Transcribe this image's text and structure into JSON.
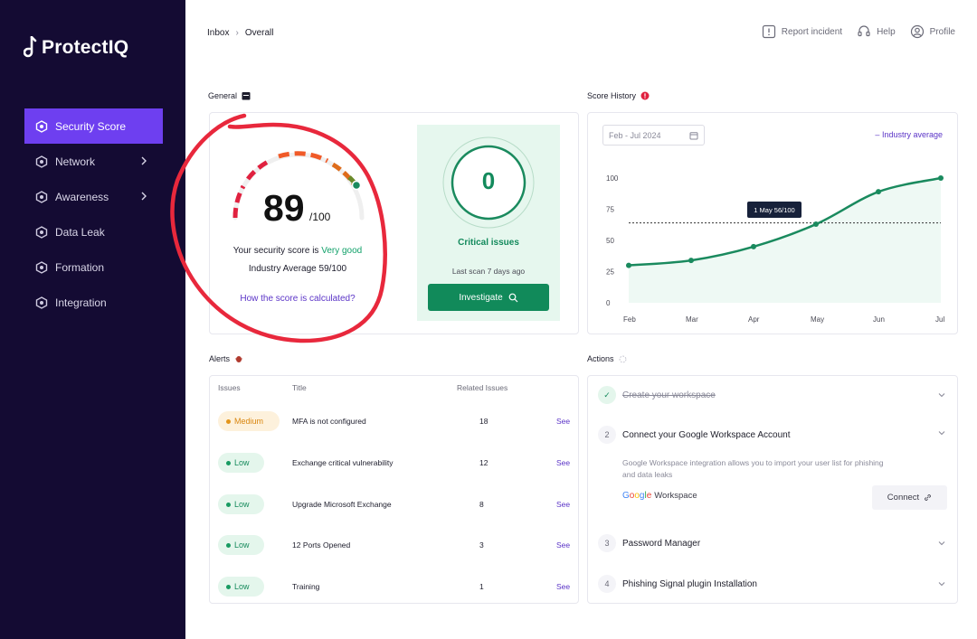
{
  "app": {
    "name": "ProtectIQ"
  },
  "sidebar": {
    "items": [
      {
        "label": "Security Score",
        "icon": "hexagon-icon",
        "active": true
      },
      {
        "label": "Network",
        "icon": "hexagon-icon",
        "has_children": true
      },
      {
        "label": "Awareness",
        "icon": "hexagon-icon",
        "has_children": true
      },
      {
        "label": "Data Leak",
        "icon": "hexagon-icon"
      },
      {
        "label": "Formation",
        "icon": "hexagon-icon"
      },
      {
        "label": "Integration",
        "icon": "hexagon-icon"
      }
    ]
  },
  "header": {
    "breadcrumb": [
      "Inbox",
      "Overall"
    ],
    "actions": {
      "report": "Report incident",
      "help": "Help",
      "profile": "Profile"
    }
  },
  "general": {
    "title": "General",
    "score": "89",
    "score_max": "/100",
    "score_fraction": 0.89,
    "score_text_prefix": "Your security score is",
    "score_rating": "Very good",
    "industry_average": "Industry Average 59/100",
    "how_link": "How the score is calculated?",
    "critical": {
      "count": "0",
      "label": "Critical issues",
      "last_scan": "Last scan 7 days ago",
      "button": "Investigate"
    }
  },
  "score_history": {
    "title": "Score History",
    "date_range": "Feb - Jul 2024",
    "legend": "Industry average",
    "tooltip": "1 May 56/100"
  },
  "chart_data": {
    "type": "line",
    "x": [
      "Feb",
      "Mar",
      "Apr",
      "May",
      "Jun",
      "Jul"
    ],
    "series": [
      {
        "values": [
          30,
          34,
          45,
          63,
          89,
          100
        ]
      }
    ],
    "reference_line": 64,
    "yticks": [
      0,
      25,
      50,
      75,
      100
    ],
    "ylim": [
      0,
      100
    ],
    "colors": {
      "line": "#1a8a5e",
      "area": "#eef9f4"
    }
  },
  "alerts": {
    "title": "Alerts",
    "columns": {
      "issues": "Issues",
      "title": "Title",
      "related": "Related Issues"
    },
    "rows": [
      {
        "severity": "Medium",
        "level": "medium",
        "title": "MFA is not configured",
        "related": "18",
        "action": "See"
      },
      {
        "severity": "Low",
        "level": "low",
        "title": "Exchange critical vulnerability",
        "related": "12",
        "action": "See"
      },
      {
        "severity": "Low",
        "level": "low",
        "title": "Upgrade Microsoft Exchange",
        "related": "8",
        "action": "See"
      },
      {
        "severity": "Low",
        "level": "low",
        "title": "12 Ports Opened",
        "related": "3",
        "action": "See"
      },
      {
        "severity": "Low",
        "level": "low",
        "title": "Training",
        "related": "1",
        "action": "See"
      }
    ]
  },
  "actions": {
    "title": "Actions",
    "items": [
      {
        "num": "",
        "title": "Create your workspace",
        "done": true
      },
      {
        "num": "2",
        "title": "Connect your Google Workspace Account",
        "desc": "Google Workspace integration allows you to import your user list for phishing and data leaks",
        "provider_word": "Workspace",
        "connect": "Connect"
      },
      {
        "num": "3",
        "title": "Password Manager"
      },
      {
        "num": "4",
        "title": "Phishing Signal plugin Installation"
      }
    ]
  }
}
